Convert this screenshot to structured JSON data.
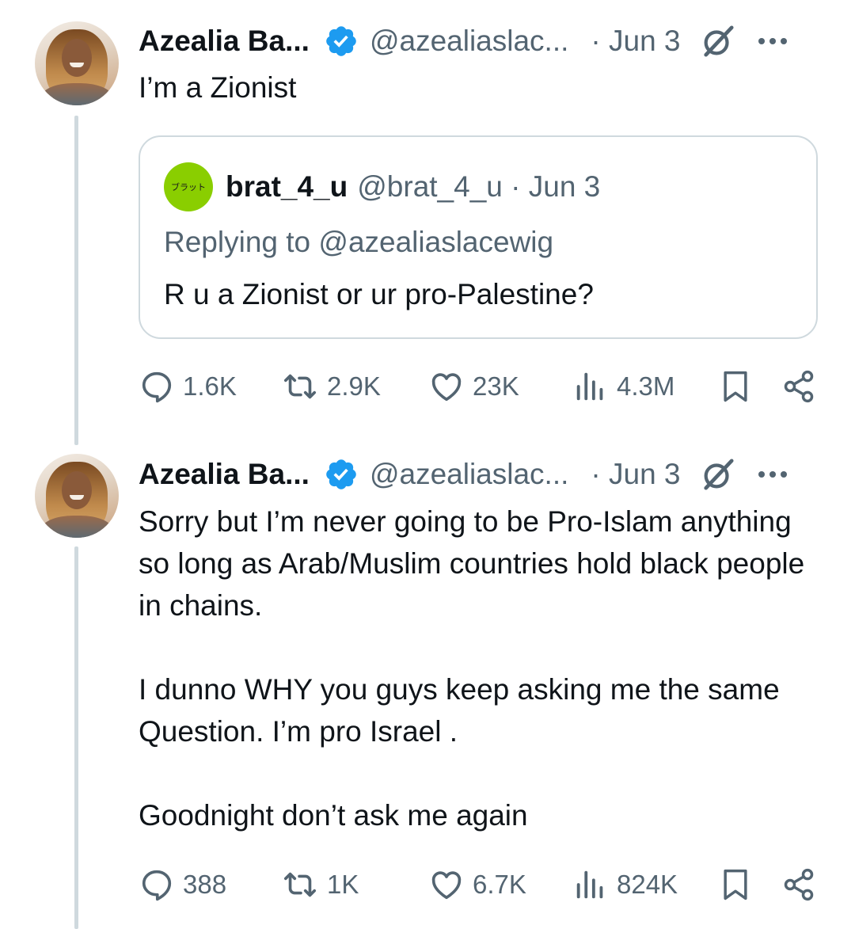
{
  "tweets": [
    {
      "author_name": "Azealia Ba...",
      "handle": "@azealiaslac...",
      "date": "· Jun 3",
      "text": [
        "I’m a Zionist"
      ],
      "quote": {
        "avatar_text": "ブラット",
        "author_name": "brat_4_u",
        "handle": "@brat_4_u · Jun 3",
        "replying": "Replying to @azealiaslacewig",
        "text": "R u a Zionist or ur pro-Palestine?"
      },
      "stats": {
        "replies": "1.6K",
        "reposts": "2.9K",
        "likes": "23K",
        "views": "4.3M"
      }
    },
    {
      "author_name": "Azealia Ba...",
      "handle": "@azealiaslac...",
      "date": "· Jun 3",
      "text": [
        "Sorry but I’m never going to be Pro-Islam anything so long as Arab/Muslim countries hold black people in chains.",
        "I dunno WHY you guys keep asking me the same Question. I’m pro Israel .",
        "Goodnight don’t ask me again"
      ],
      "stats": {
        "replies": "388",
        "reposts": "1K",
        "likes": "6.7K",
        "views": "824K"
      }
    }
  ],
  "colors": {
    "text": "#0f1419",
    "muted": "#536471",
    "verified": "#1d9bf0",
    "border": "#cfd9de",
    "quote_avatar": "#8ace00"
  },
  "icons": [
    "verified-badge-icon",
    "grok-icon",
    "more-icon",
    "reply-icon",
    "repost-icon",
    "like-icon",
    "views-icon",
    "bookmark-icon",
    "share-icon"
  ]
}
